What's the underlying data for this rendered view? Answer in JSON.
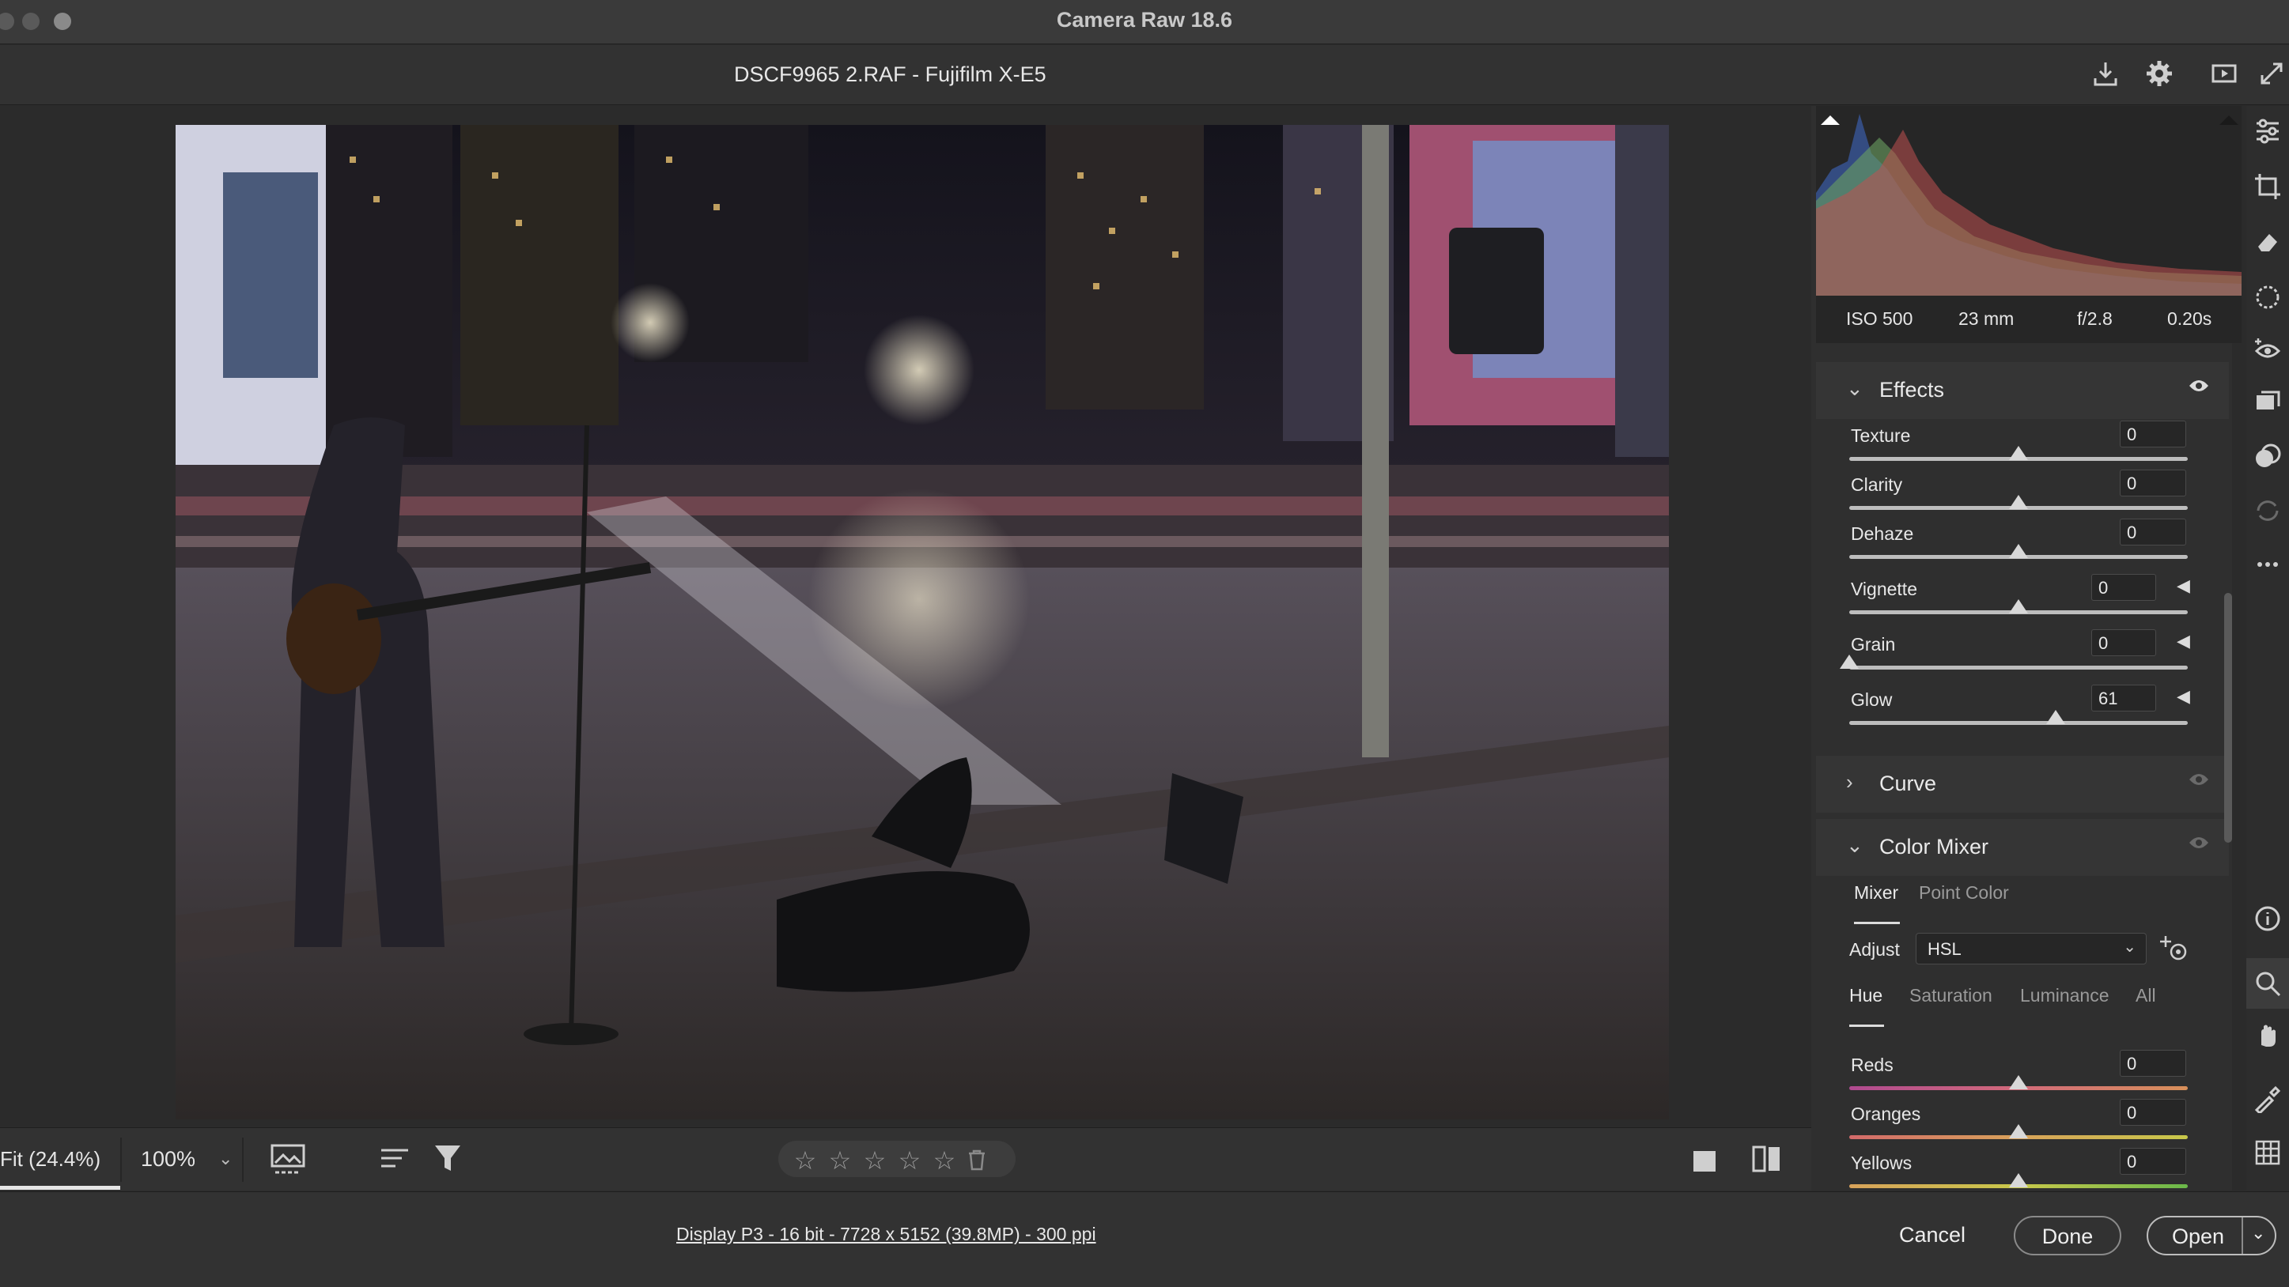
{
  "window": {
    "title": "Camera Raw 18.6"
  },
  "file": {
    "title": "DSCF9965 2.RAF  -  Fujifilm X-E5"
  },
  "top_icons": [
    "download-icon",
    "gear-icon",
    "slideshow-icon",
    "expand-icon"
  ],
  "bottom": {
    "fit": "Fit (24.4%)",
    "zoom": "100%",
    "zoom_chevron": "⌄",
    "star_glyph": "☆",
    "trash_glyph": "🗑"
  },
  "footer": {
    "info": "Display P3 - 16 bit - 7728 x 5152 (39.8MP) - 300 ppi",
    "cancel": "Cancel",
    "done": "Done",
    "open": "Open",
    "open_menu": "⌄"
  },
  "exif": {
    "iso": "ISO 500",
    "focal": "23 mm",
    "aperture": "f/2.8",
    "shutter": "0.20s"
  },
  "effects": {
    "title": "Effects",
    "sliders": [
      {
        "label": "Texture",
        "value": "0",
        "level": 0.5
      },
      {
        "label": "Clarity",
        "value": "0",
        "level": 0.5
      },
      {
        "label": "Dehaze",
        "value": "0",
        "level": 0.5
      },
      {
        "label": "Vignette",
        "value": "0",
        "level": 0.5
      },
      {
        "label": "Grain",
        "value": "0",
        "level": 0.0
      },
      {
        "label": "Glow",
        "value": "61",
        "level": 0.61
      }
    ]
  },
  "curve": {
    "title": "Curve"
  },
  "color_mixer": {
    "title": "Color Mixer",
    "tabs": [
      "Mixer",
      "Point Color"
    ],
    "adjust_label": "Adjust",
    "adjust_value": "HSL",
    "subtabs": [
      "Hue",
      "Saturation",
      "Luminance",
      "All"
    ],
    "sliders": [
      {
        "label": "Reds",
        "value": "0",
        "level": 0.5
      },
      {
        "label": "Oranges",
        "value": "0",
        "level": 0.5
      },
      {
        "label": "Yellows",
        "value": "0",
        "level": 0.5
      }
    ]
  },
  "colors": {
    "accent": "#e6e6e6",
    "panel": "#2f2f2f",
    "reds": "#d36a7a",
    "oranges": "#d8a25a",
    "yellows": "#c8c84a"
  }
}
